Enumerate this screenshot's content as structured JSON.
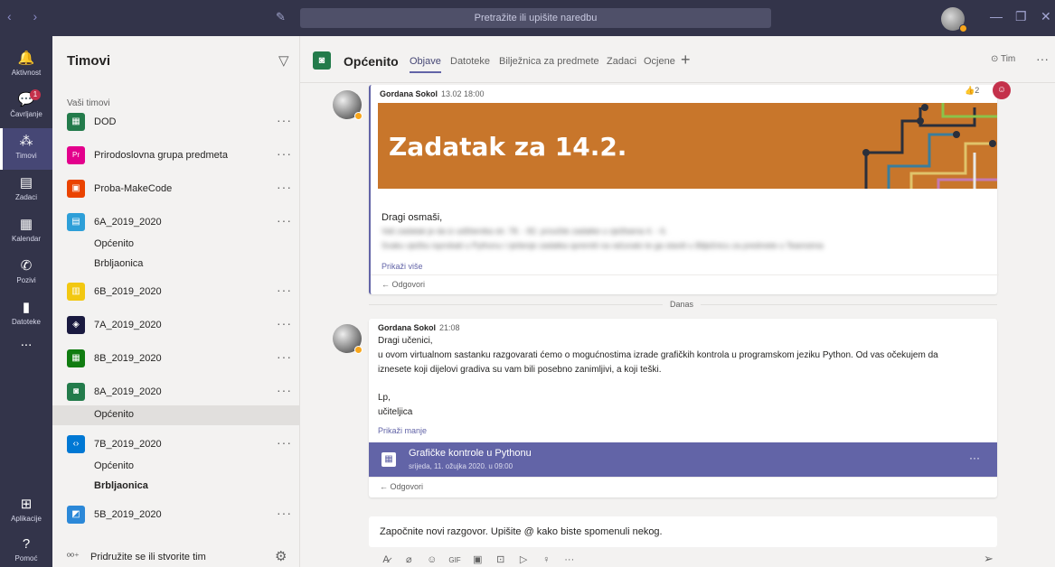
{
  "titlebar": {
    "search_placeholder": "Pretražite ili upišite naredbu",
    "nav": "‹ ›",
    "compose_icon": "compose-icon",
    "minimize": "—",
    "maximize": "❐",
    "close": "✕"
  },
  "rail": {
    "items": [
      {
        "label": "Aktivnost",
        "icon": "bell-icon",
        "glyph": "🔔"
      },
      {
        "label": "Čavrljanje",
        "icon": "chat-icon",
        "glyph": "💬",
        "badge": "1"
      },
      {
        "label": "Timovi",
        "icon": "teams-icon",
        "glyph": "⁂"
      },
      {
        "label": "Zadaci",
        "icon": "assignments-icon",
        "glyph": "▤"
      },
      {
        "label": "Kalendar",
        "icon": "calendar-icon",
        "glyph": "▦"
      },
      {
        "label": "Pozivi",
        "icon": "phone-icon",
        "glyph": "✆"
      },
      {
        "label": "Datoteke",
        "icon": "files-icon",
        "glyph": "▮"
      },
      {
        "label": "...",
        "icon": "more-icon",
        "glyph": ""
      },
      {
        "label": "Aplikacije",
        "icon": "apps-icon",
        "glyph": "⊞"
      },
      {
        "label": "Pomoć",
        "icon": "help-icon",
        "glyph": "?"
      }
    ]
  },
  "teams_panel": {
    "title": "Timovi",
    "section_label": "Vaši timovi",
    "more": "···",
    "teams": [
      {
        "name": "DOD",
        "color": "#237b4b",
        "glyph": "▦"
      },
      {
        "name": "Prirodoslovna grupa predmeta",
        "color": "#e3008c",
        "glyph": "Pr"
      },
      {
        "name": "Proba-MakeCode",
        "color": "#ea4300",
        "glyph": "▣"
      },
      {
        "name": "6A_2019_2020",
        "color": "#2d9fd8",
        "glyph": "▤"
      },
      {
        "name": "6B_2019_2020",
        "color": "#f2c811",
        "glyph": "▥"
      },
      {
        "name": "7A_2019_2020",
        "color": "#1a1a40",
        "glyph": "◈"
      },
      {
        "name": "8B_2019_2020",
        "color": "#107c10",
        "glyph": "▦"
      },
      {
        "name": "8A_2019_2020",
        "color": "#237b4b",
        "glyph": "◙"
      },
      {
        "name": "7B_2019_2020",
        "color": "#0078d4",
        "glyph": "‹›"
      },
      {
        "name": "5B_2019_2020",
        "color": "#2b88d8",
        "glyph": "◩"
      }
    ],
    "channels": {
      "6A_1": "Općenito",
      "6A_2": "Brbljaonica",
      "8A_1": "Općenito",
      "7B_1": "Općenito",
      "7B_2": "Brbljaonica"
    },
    "join_label": "Pridružite se ili stvorite tim"
  },
  "channel": {
    "name": "Općenito",
    "tabs": [
      "Objave",
      "Datoteke",
      "Bilježnica za predmete",
      "Zadaci",
      "Ocjene"
    ],
    "add": "+",
    "team_button": "⊙ Tim",
    "more": "···"
  },
  "post1": {
    "author": "Gordana Sokol",
    "time": "13.02 18:00",
    "reaction_count": "2",
    "banner_title": "Zadatak za 14.2.",
    "greeting": "Dragi osmaši,",
    "blurred_1": "Vaš zadatak je da iz udžbenika str. 78. - 82. proučite zadatke u vježbama 4. - 6.",
    "blurred_2": "Svaku vježbu isprobati u Pythonu i rješenje zadatka spremiti na računalo te ga staviti u Bilježnicu za predmete u Teamsima",
    "show_more": "Prikaži više",
    "reply": "← Odgovori"
  },
  "divider_label": "Danas",
  "post2": {
    "author": "Gordana Sokol",
    "time": "21:08",
    "line1": "Dragi učenici,",
    "line2": "u ovom virtualnom sastanku razgovarati ćemo o mogućnostima izrade grafičkih kontrola u programskom jeziku Python. Od vas očekujem da",
    "line3": "iznesete koji dijelovi gradiva su vam bili posebno zanimljivi, a koji teški.",
    "line4": "Lp,",
    "line5": "učiteljica",
    "show_less": "Prikaži manje",
    "meeting_title": "Grafičke kontrole u Pythonu",
    "meeting_date": "srijeda, 11. ožujka 2020. u 09:00",
    "meeting_more": "···",
    "reply": "← Odgovori"
  },
  "compose": {
    "placeholder": "Započnite novi razgovor. Upišite @ kako biste spomenuli nekog.",
    "tools": [
      "A̷",
      "⌀",
      "☺",
      "GIF",
      "▣",
      "⊡",
      "▷",
      "♀",
      "···"
    ],
    "send": "➢"
  }
}
